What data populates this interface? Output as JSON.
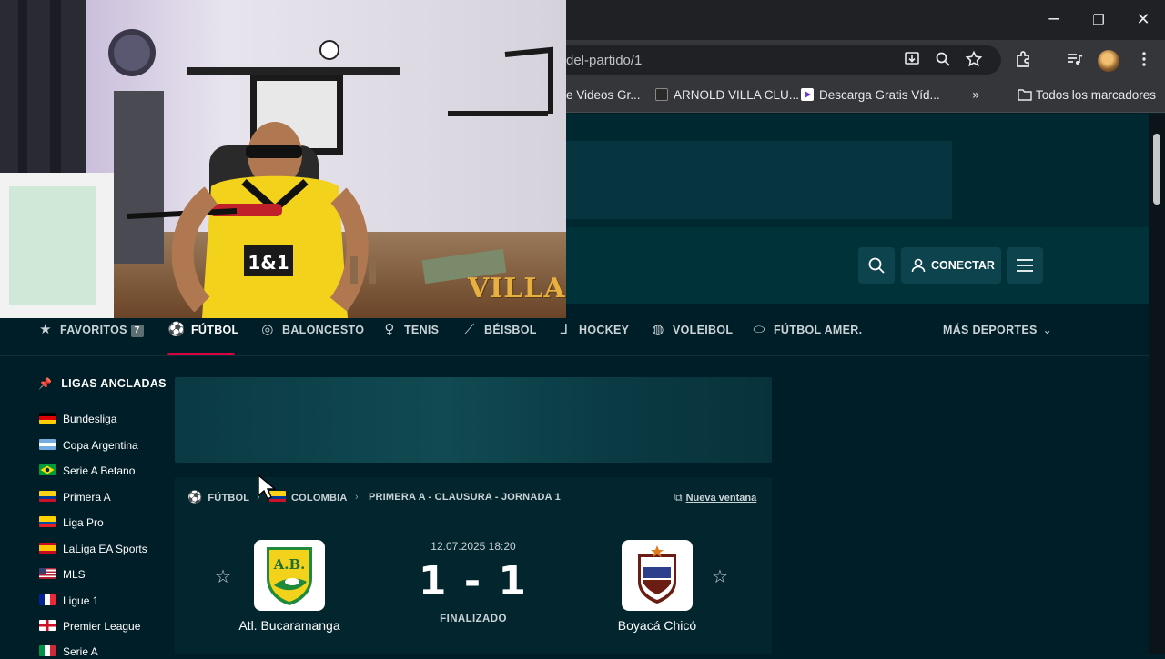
{
  "browser": {
    "url_text": "del-partido/1",
    "bookmarks": [
      "e Videos Gr...",
      "ARNOLD VILLA CLU...",
      "Descarga Gratis Víd...",
      "Todos los marcadores"
    ],
    "window_controls": {
      "minimize": "─",
      "restore": "❐",
      "close": "✕"
    },
    "toolbar_icons": [
      "download-icon",
      "zoom-icon",
      "bookmark-star-icon",
      "extensions-icon",
      "media-icon",
      "profile-avatar",
      "more-menu-icon"
    ]
  },
  "header": {
    "connect_label": "CONECTAR"
  },
  "sports_nav": {
    "items": [
      {
        "label": "FAVORITOS",
        "badge": "7",
        "icon": "star-icon"
      },
      {
        "label": "FÚTBOL",
        "icon": "soccer-ball-icon",
        "active": true
      },
      {
        "label": "BALONCESTO",
        "icon": "basketball-icon"
      },
      {
        "label": "TENIS",
        "icon": "tennis-icon"
      },
      {
        "label": "BÉISBOL",
        "icon": "baseball-bat-icon"
      },
      {
        "label": "HOCKEY",
        "icon": "hockey-icon"
      },
      {
        "label": "VOLEIBOL",
        "icon": "volleyball-icon"
      },
      {
        "label": "FÚTBOL AMER.",
        "icon": "american-football-icon"
      }
    ],
    "more_label": "MÁS DEPORTES"
  },
  "sidebar": {
    "title": "LIGAS ANCLADAS",
    "leagues": [
      {
        "label": "Bundesliga",
        "flag": "germany"
      },
      {
        "label": "Copa Argentina",
        "flag": "argentina"
      },
      {
        "label": "Serie A Betano",
        "flag": "brazil"
      },
      {
        "label": "Primera A",
        "flag": "colombia"
      },
      {
        "label": "Liga Pro",
        "flag": "ecuador"
      },
      {
        "label": "LaLiga EA Sports",
        "flag": "spain"
      },
      {
        "label": "MLS",
        "flag": "usa"
      },
      {
        "label": "Ligue 1",
        "flag": "france"
      },
      {
        "label": "Premier League",
        "flag": "england"
      },
      {
        "label": "Serie A",
        "flag": "italy"
      }
    ]
  },
  "match": {
    "breadcrumb": [
      "FÚTBOL",
      "COLOMBIA",
      "PRIMERA A - CLAUSURA - JORNADA 1"
    ],
    "new_window_label": "Nueva ventana",
    "datetime": "12.07.2025 18:20",
    "score": "1 - 1",
    "status": "FINALIZADO",
    "home_team": "Atl. Bucaramanga",
    "away_team": "Boyacá Chicó",
    "home_logo_text": "A.B."
  },
  "webcam": {
    "watermark": "VILLA",
    "jersey_text": "1&1"
  }
}
